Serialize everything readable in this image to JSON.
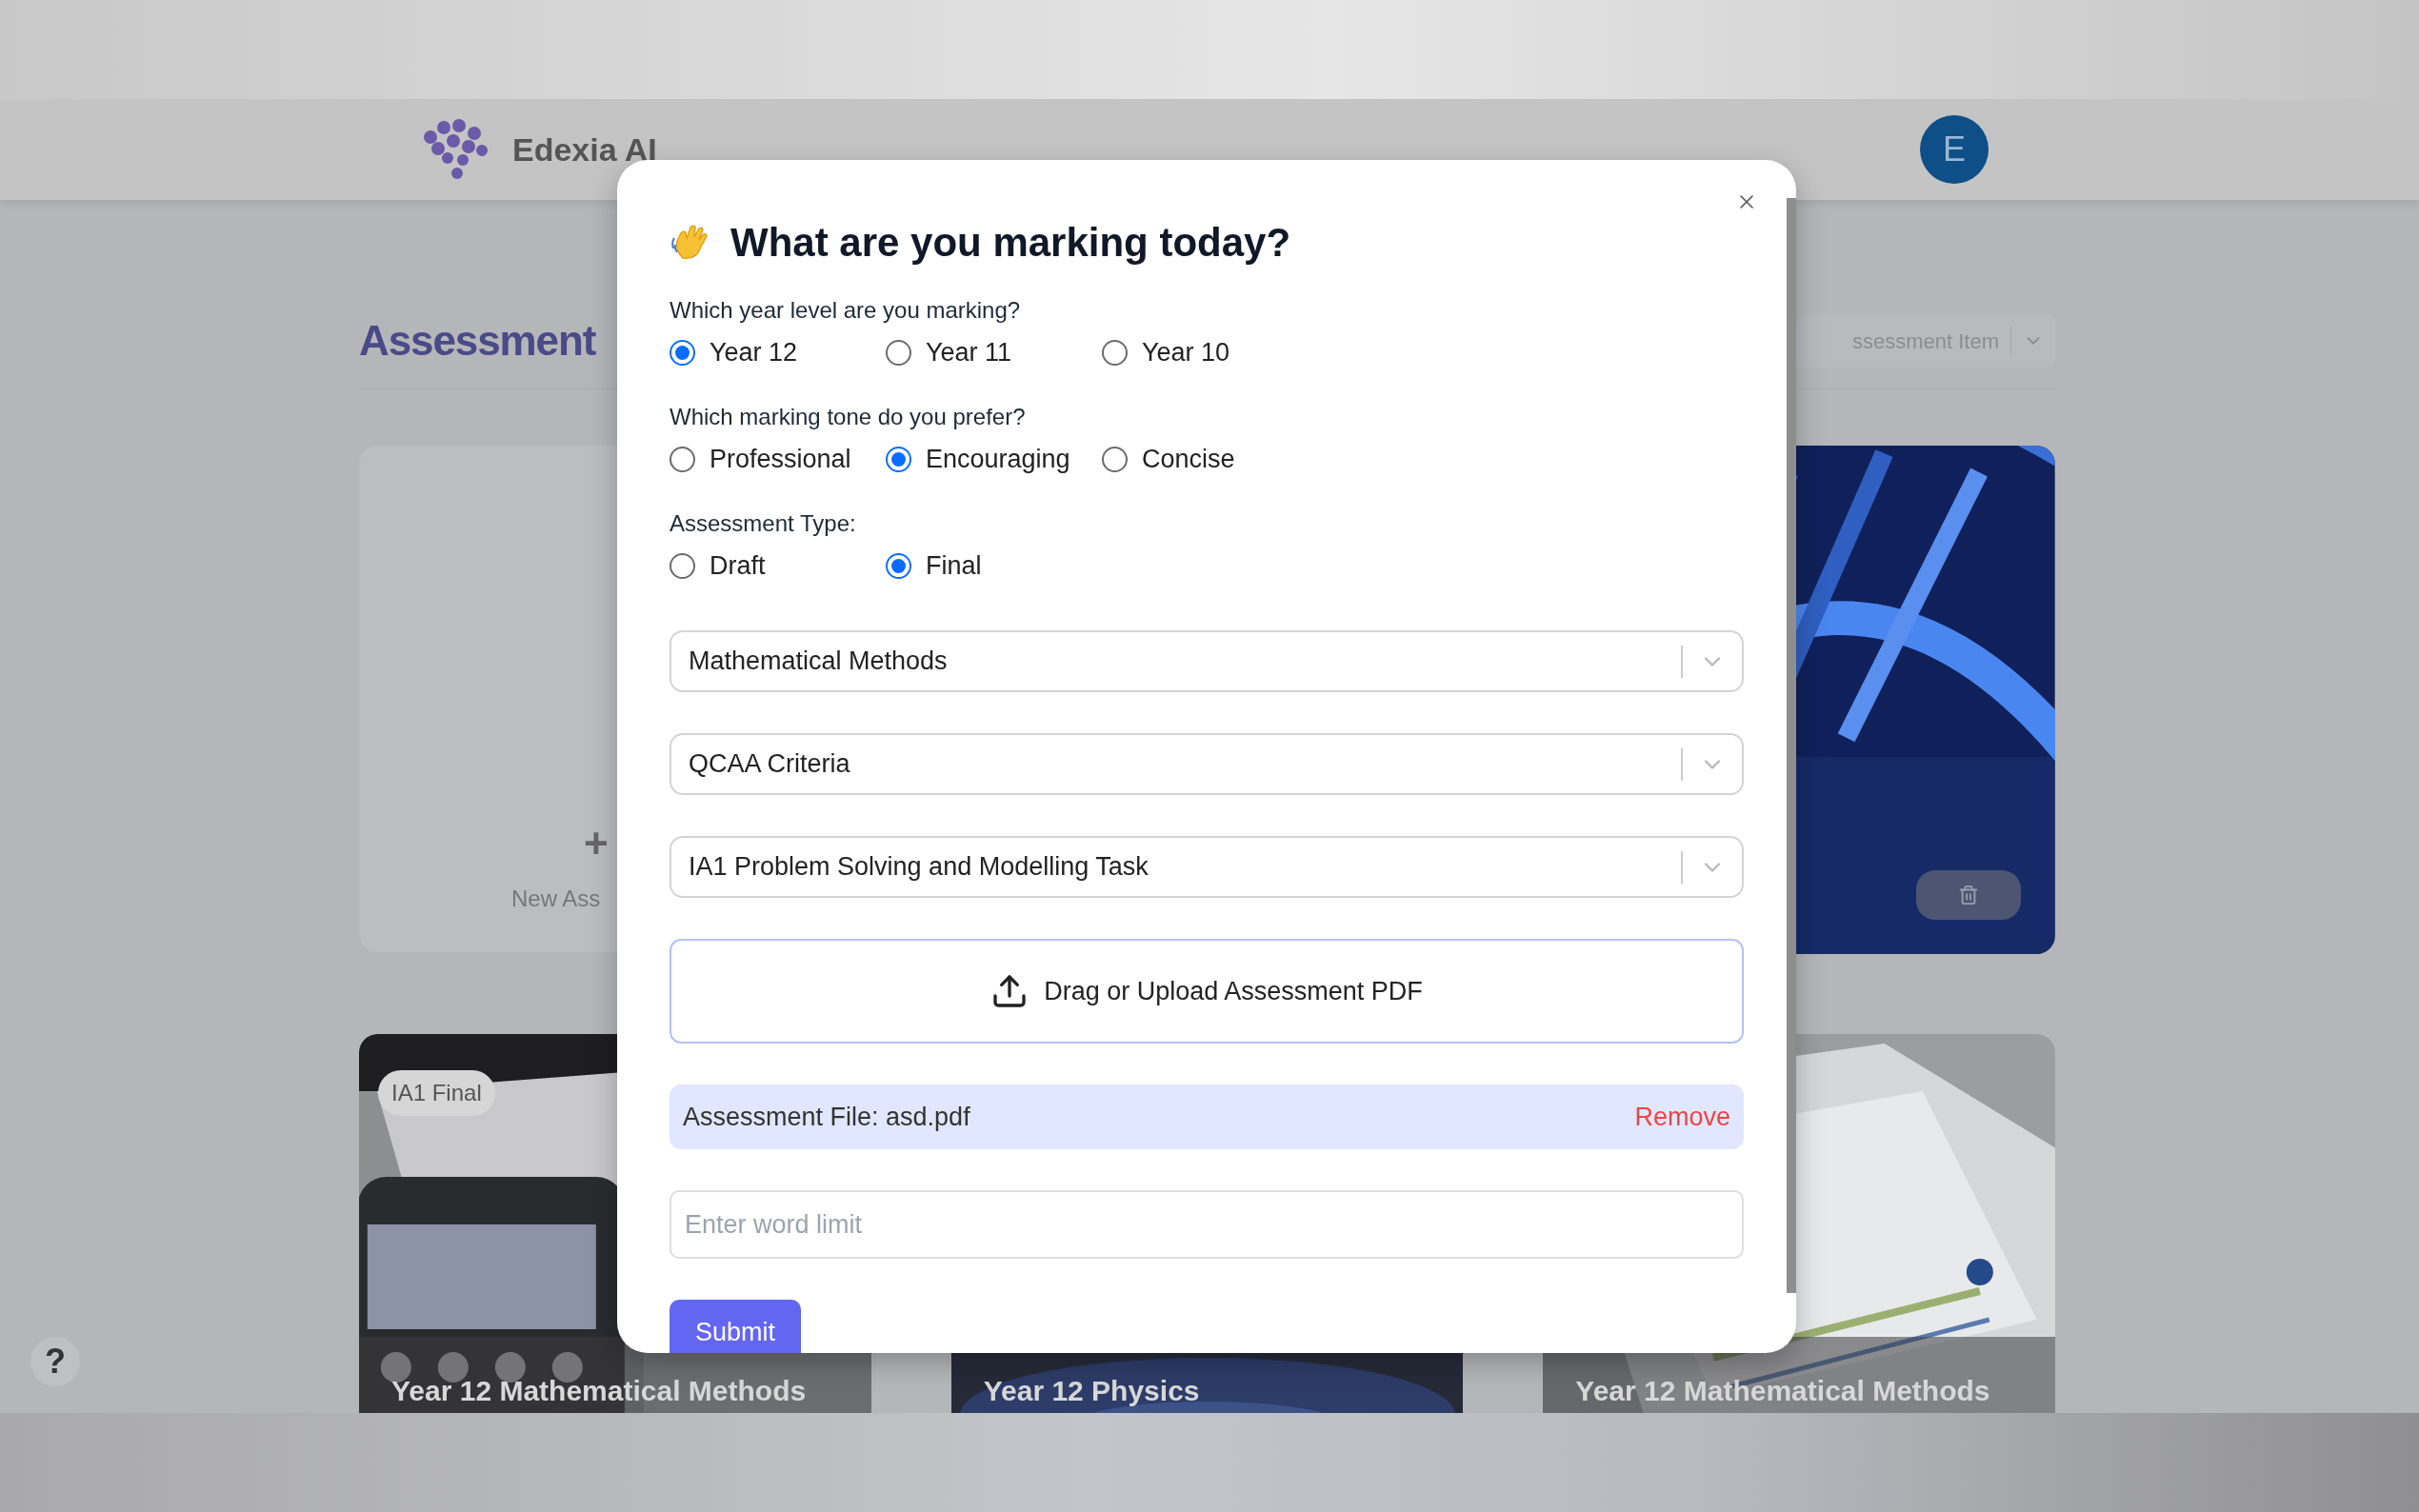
{
  "app": {
    "logo_text": "Edexia AI",
    "avatar": "E",
    "page_title": "Assessment",
    "filter_select": "ssessment Item",
    "new_card": {
      "plus": "+",
      "label": "New Ass"
    },
    "cards": [
      {
        "badge": "IA1 Final",
        "caption": "Year 12 Mathematical Methods"
      },
      {
        "caption": "Year 12 Physics"
      },
      {
        "caption": "Year 12 Mathematical Methods"
      }
    ],
    "help_button": "?"
  },
  "modal": {
    "title": "What are you marking today?",
    "groups": [
      {
        "label": "Which year level are you marking?",
        "options": [
          {
            "label": "Year 12",
            "selected": true
          },
          {
            "label": "Year 11",
            "selected": false
          },
          {
            "label": "Year 10",
            "selected": false
          }
        ]
      },
      {
        "label": "Which marking tone do you prefer?",
        "options": [
          {
            "label": "Professional",
            "selected": false
          },
          {
            "label": "Encouraging",
            "selected": true
          },
          {
            "label": "Concise",
            "selected": false
          }
        ]
      },
      {
        "label": "Assessment Type:",
        "options": [
          {
            "label": "Draft",
            "selected": false
          },
          {
            "label": "Final",
            "selected": true
          }
        ]
      }
    ],
    "selects": [
      {
        "value": "Mathematical Methods"
      },
      {
        "value": "QCAA Criteria"
      },
      {
        "value": "IA1 Problem Solving and Modelling Task"
      }
    ],
    "upload": {
      "label": "Drag or Upload Assessment PDF"
    },
    "file": {
      "label": "Assessment File: asd.pdf",
      "action": "Remove"
    },
    "word_limit": {
      "placeholder": "Enter word limit"
    },
    "submit": "Submit"
  }
}
